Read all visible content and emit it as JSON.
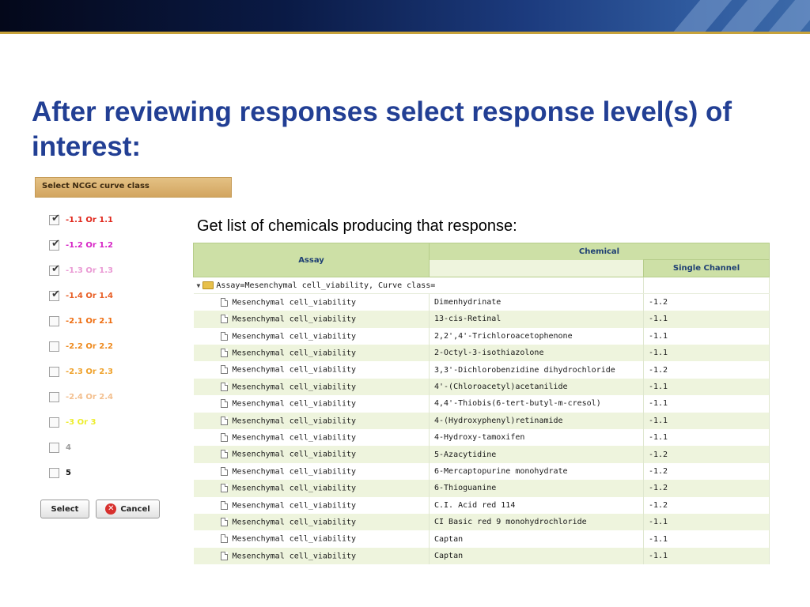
{
  "slide": {
    "title": "After reviewing responses select response level(s) of interest:",
    "subtitle": "Get list of chemicals producing that response:"
  },
  "curve_panel": {
    "header": "Select NCGC curve class",
    "items": [
      {
        "label": "-1.1 Or 1.1",
        "checked": true,
        "color": "#e0261b"
      },
      {
        "label": "-1.2 Or 1.2",
        "checked": true,
        "color": "#d624c5"
      },
      {
        "label": "-1.3 Or 1.3",
        "checked": true,
        "color": "#ea9ad4"
      },
      {
        "label": "-1.4 Or 1.4",
        "checked": true,
        "color": "#e85f26"
      },
      {
        "label": "-2.1 Or 2.1",
        "checked": false,
        "color": "#ee6d10"
      },
      {
        "label": "-2.2 Or 2.2",
        "checked": false,
        "color": "#ee8a1e"
      },
      {
        "label": "-2.3 Or 2.3",
        "checked": false,
        "color": "#efa12a"
      },
      {
        "label": "-2.4 Or 2.4",
        "checked": false,
        "color": "#f3bf8e"
      },
      {
        "label": "-3 Or 3",
        "checked": false,
        "color": "#eded2b"
      },
      {
        "label": "4",
        "checked": false,
        "color": "#9a9a9a"
      },
      {
        "label": "5",
        "checked": false,
        "color": "#111111"
      }
    ],
    "select_label": "Select",
    "cancel_label": "Cancel"
  },
  "grid": {
    "headers": {
      "assay": "Assay",
      "chemical": "Chemical",
      "single_channel": "Single Channel"
    },
    "group_label": "Assay=Mesenchymal cell_viability, Curve class=",
    "rows": [
      {
        "assay": "Mesenchymal cell_viability",
        "chemical": "Dimenhydrinate",
        "single_channel": "-1.2"
      },
      {
        "assay": "Mesenchymal cell_viability",
        "chemical": "13-cis-Retinal",
        "single_channel": "-1.1"
      },
      {
        "assay": "Mesenchymal cell_viability",
        "chemical": "2,2',4'-Trichloroacetophenone",
        "single_channel": "-1.1"
      },
      {
        "assay": "Mesenchymal cell_viability",
        "chemical": "2-Octyl-3-isothiazolone",
        "single_channel": "-1.1"
      },
      {
        "assay": "Mesenchymal cell_viability",
        "chemical": "3,3'-Dichlorobenzidine dihydrochloride",
        "single_channel": "-1.2"
      },
      {
        "assay": "Mesenchymal cell_viability",
        "chemical": "4'-(Chloroacetyl)acetanilide",
        "single_channel": "-1.1"
      },
      {
        "assay": "Mesenchymal cell_viability",
        "chemical": "4,4'-Thiobis(6-tert-butyl-m-cresol)",
        "single_channel": "-1.1"
      },
      {
        "assay": "Mesenchymal cell_viability",
        "chemical": "4-(Hydroxyphenyl)retinamide",
        "single_channel": "-1.1"
      },
      {
        "assay": "Mesenchymal cell_viability",
        "chemical": "4-Hydroxy-tamoxifen",
        "single_channel": "-1.1"
      },
      {
        "assay": "Mesenchymal cell_viability",
        "chemical": "5-Azacytidine",
        "single_channel": "-1.2"
      },
      {
        "assay": "Mesenchymal cell_viability",
        "chemical": "6-Mercaptopurine monohydrate",
        "single_channel": "-1.2"
      },
      {
        "assay": "Mesenchymal cell_viability",
        "chemical": "6-Thioguanine",
        "single_channel": "-1.2"
      },
      {
        "assay": "Mesenchymal cell_viability",
        "chemical": "C.I. Acid red 114",
        "single_channel": "-1.2"
      },
      {
        "assay": "Mesenchymal cell_viability",
        "chemical": "CI Basic red 9 monohydrochloride",
        "single_channel": "-1.1"
      },
      {
        "assay": "Mesenchymal cell_viability",
        "chemical": "Captan",
        "single_channel": "-1.1"
      },
      {
        "assay": "Mesenchymal cell_viability",
        "chemical": "Captan",
        "single_channel": "-1.1"
      }
    ]
  }
}
